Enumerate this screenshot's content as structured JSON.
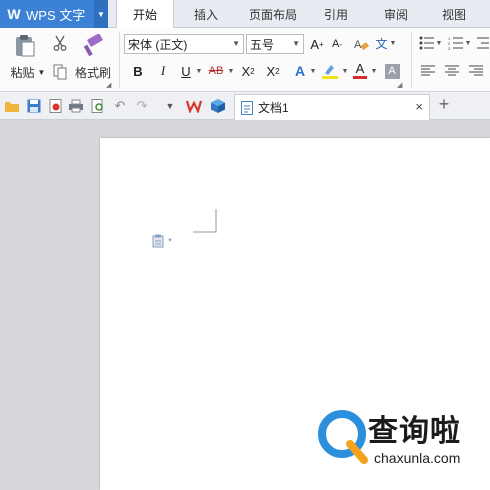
{
  "app": {
    "name": "WPS 文字"
  },
  "tabs": [
    "开始",
    "插入",
    "页面布局",
    "引用",
    "审阅",
    "视图"
  ],
  "ribbon": {
    "paste_label": "粘贴",
    "format_painter_label": "格式刷",
    "font_name": "宋体 (正文)",
    "font_size": "五号",
    "bold": "B",
    "italic": "I",
    "underline": "U",
    "strikethrough": "AB",
    "superscript": "X",
    "subscript": "X",
    "font_color_letter": "A",
    "phonetic": "文"
  },
  "document": {
    "tab_title": "文档1"
  },
  "watermark": {
    "brand": "查询啦",
    "url": "chaxunla.com"
  },
  "colors": {
    "accent": "#3b82d6",
    "wm_blue": "#2b8fdc",
    "wm_orange": "#f4a21b"
  }
}
